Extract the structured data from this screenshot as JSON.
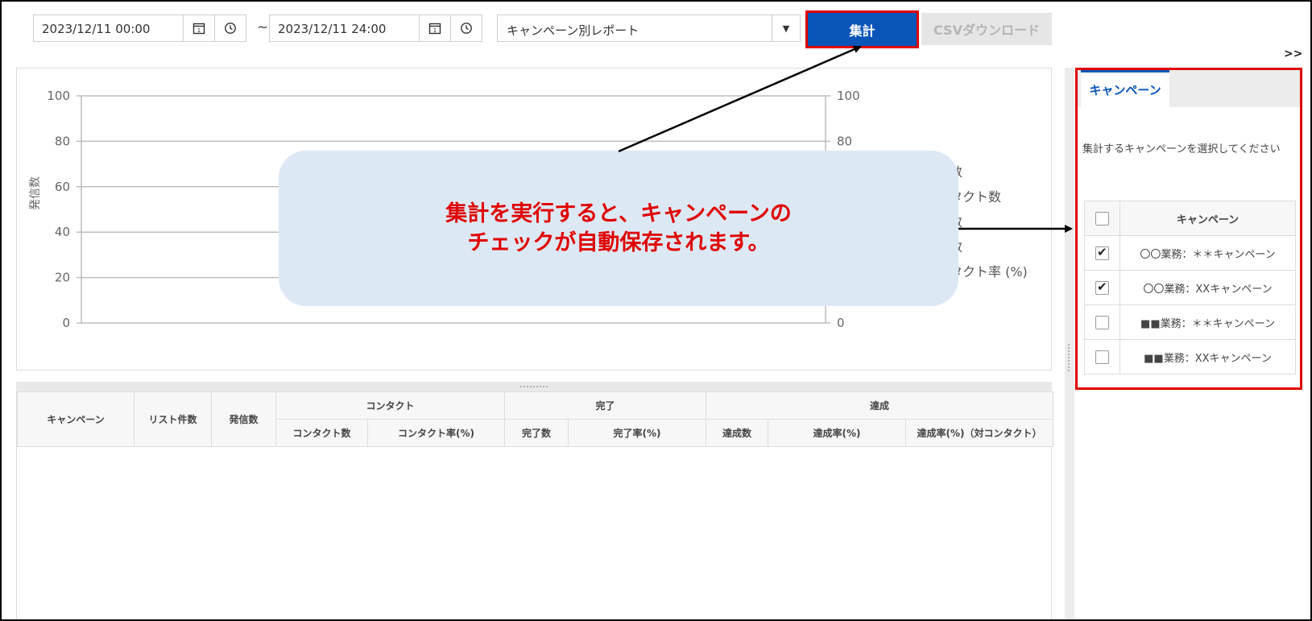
{
  "toolbar": {
    "start_datetime": "2023/12/11 00:00",
    "separator": "~",
    "end_datetime": "2023/12/11 24:00",
    "report_type": "キャンペーン別レポート",
    "sum_label": "集計",
    "csv_label": "CSVダウンロード",
    "expand_label": ">>"
  },
  "chart_data": {
    "type": "line",
    "ylabel": "発信数",
    "ylim": [
      0,
      100
    ],
    "y_ticks": [
      0,
      20,
      40,
      60,
      80,
      100
    ],
    "y2lim": [
      0,
      100
    ],
    "y2_ticks": [
      0,
      80,
      100
    ],
    "grid": true,
    "legend_position": "right",
    "legend_visible": [
      "数",
      "タクト数",
      "数",
      "数",
      "タクト率 (%)"
    ],
    "series": []
  },
  "callout": {
    "line1": "集計を実行すると、キャンペーンの",
    "line2": "チェックが自動保存されます。"
  },
  "table": {
    "headers": {
      "campaign": "キャンペーン",
      "list_count": "リスト件数",
      "calls": "発信数",
      "contact": "コンタクト",
      "complete": "完了",
      "achieve": "達成",
      "contact_count": "コンタクト数",
      "contact_rate": "コンタクト率(%)",
      "complete_count": "完了数",
      "complete_rate": "完了率(%)",
      "achieve_count": "達成数",
      "achieve_rate": "達成率(%)",
      "achieve_rate_contact": "達成率(%)（対コンタクト）"
    },
    "rows": []
  },
  "side_panel": {
    "tab_label": "キャンペーン",
    "instruction": "集計するキャンペーンを選択してください",
    "column_header": "キャンペーン",
    "campaigns": [
      {
        "name": "〇〇業務：＊＊キャンペーン",
        "checked": true
      },
      {
        "name": "〇〇業務：XXキャンペーン",
        "checked": true
      },
      {
        "name": "■■業務：＊＊キャンペーン",
        "checked": false
      },
      {
        "name": "■■業務：XXキャンペーン",
        "checked": false
      }
    ]
  }
}
